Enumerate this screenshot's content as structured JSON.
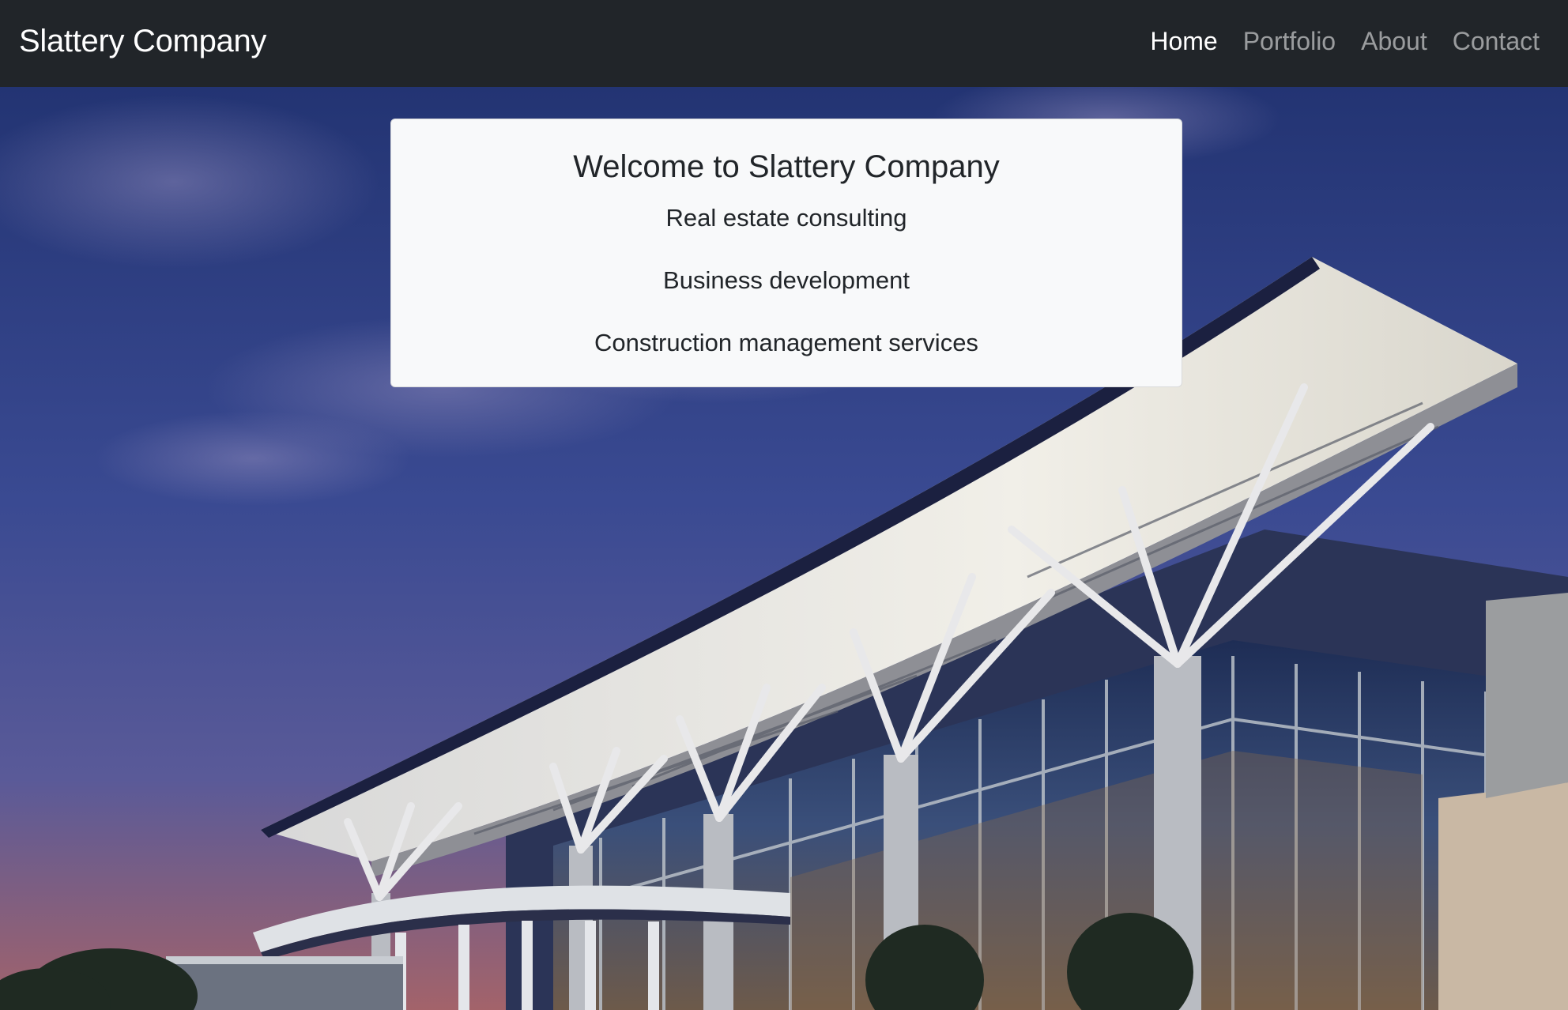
{
  "navbar": {
    "brand": "Slattery Company",
    "links": [
      {
        "label": "Home",
        "active": true
      },
      {
        "label": "Portfolio",
        "active": false
      },
      {
        "label": "About",
        "active": false
      },
      {
        "label": "Contact",
        "active": false
      }
    ]
  },
  "hero": {
    "card": {
      "title": "Welcome to Slattery Company",
      "services": [
        "Real estate consulting",
        "Business development",
        "Construction management services"
      ]
    }
  },
  "colors": {
    "navbar_bg": "#212529",
    "card_bg": "#f8f9fa",
    "sky_top": "#2b3a7a",
    "sky_bottom": "#8a5a6a"
  }
}
